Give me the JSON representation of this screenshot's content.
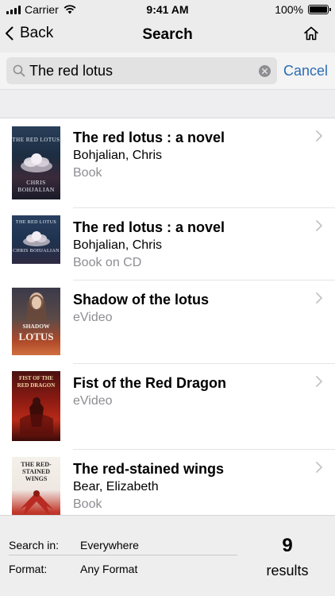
{
  "status_bar": {
    "carrier": "Carrier",
    "time": "9:41 AM",
    "battery": "100%",
    "battery_level": 1.0
  },
  "nav": {
    "back_label": "Back",
    "title": "Search",
    "home_icon": "home-icon"
  },
  "search": {
    "value": "The red lotus",
    "cancel_label": "Cancel"
  },
  "results": [
    {
      "title": "The red lotus : a novel",
      "author": "Bohjalian, Chris",
      "format": "Book",
      "cover_text_top": "THE RED LOTUS",
      "cover_text_bottom": "CHRIS BOHJALIAN"
    },
    {
      "title": "The red lotus : a novel",
      "author": "Bohjalian, Chris",
      "format": "Book on CD",
      "cover_text_top": "THE RED LOTUS",
      "cover_text_bottom": "CHRIS BOHJALIAN"
    },
    {
      "title": "Shadow of the lotus",
      "format": "eVideo",
      "cover_text_top": "SHADOW",
      "cover_text_bottom": "LOTUS"
    },
    {
      "title": "Fist of the Red Dragon",
      "format": "eVideo",
      "cover_text_top": "FIST OF THE RED DRAGON"
    },
    {
      "title": "The red-stained wings",
      "author": "Bear, Elizabeth",
      "format": "Book",
      "cover_text_top": "THE RED-STAINED WINGS"
    }
  ],
  "filters": {
    "search_in_label": "Search in:",
    "search_in_value": "Everywhere",
    "format_label": "Format:",
    "format_value": "Any Format"
  },
  "summary": {
    "count": "9",
    "count_label": "results"
  },
  "colors": {
    "accent": "#2b6cb5",
    "secondary_text": "#8e8e93",
    "bar_background": "#ececec"
  }
}
